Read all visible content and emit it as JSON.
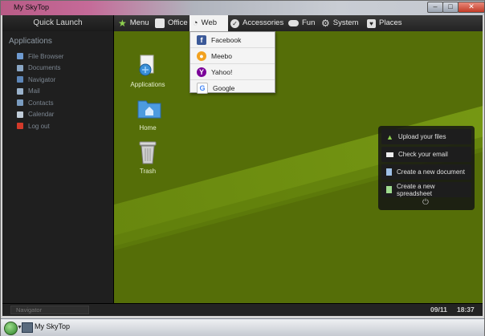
{
  "window": {
    "title": "My SkyTop"
  },
  "topbar": {
    "quick_launch": "Quick Launch",
    "menus": [
      {
        "label": "Menu",
        "icon": "star-icon"
      },
      {
        "label": "Office",
        "icon": "briefcase-icon"
      },
      {
        "label": "Web",
        "icon": "rss-icon",
        "active": true
      },
      {
        "label": "Accessories",
        "icon": "check-icon"
      },
      {
        "label": "Fun",
        "icon": "gamepad-icon"
      },
      {
        "label": "System",
        "icon": "gear-icon"
      },
      {
        "label": "Places",
        "icon": "heart-icon"
      }
    ]
  },
  "web_menu": {
    "items": [
      {
        "label": "Facebook",
        "icon": "facebook-icon",
        "color": "#3b5998"
      },
      {
        "label": "Meebo",
        "icon": "meebo-icon",
        "color": "#f2a11f"
      },
      {
        "label": "Yahoo!",
        "icon": "yahoo-icon",
        "color": "#7b0099"
      },
      {
        "label": "Google",
        "icon": "google-icon",
        "color": "#4285f4"
      }
    ]
  },
  "sidebar": {
    "heading": "Applications",
    "items": [
      {
        "label": "File Browser",
        "icon": "folder-icon"
      },
      {
        "label": "Documents",
        "icon": "documents-icon"
      },
      {
        "label": "Navigator",
        "icon": "navigator-icon"
      },
      {
        "label": "Mail",
        "icon": "mail-icon"
      },
      {
        "label": "Contacts",
        "icon": "contacts-icon"
      },
      {
        "label": "Calendar",
        "icon": "calendar-icon"
      },
      {
        "label": "Log out",
        "icon": "logout-icon"
      }
    ]
  },
  "desktop": {
    "icons": [
      {
        "label": "Applications",
        "icon": "applications-icon"
      },
      {
        "label": "Home",
        "icon": "home-folder-icon"
      },
      {
        "label": "Trash",
        "icon": "trash-icon"
      }
    ]
  },
  "quick_panel": {
    "items": [
      {
        "label": "Upload your files",
        "icon": "upload-icon"
      },
      {
        "label": "Check your email",
        "icon": "email-icon"
      },
      {
        "label": "Create a new document",
        "icon": "document-icon"
      },
      {
        "label": "Create a new spreadsheet",
        "icon": "spreadsheet-icon"
      }
    ],
    "power_icon": "power-icon"
  },
  "bottombar": {
    "navigator_placeholder": "Navigator",
    "date": "09/11",
    "time": "18:37"
  },
  "taskbar": {
    "label": "My SkyTop"
  },
  "colors": {
    "desktop_green": "#556e08",
    "accent_green": "#7ea216",
    "panel_dark": "#1d1d1d"
  }
}
